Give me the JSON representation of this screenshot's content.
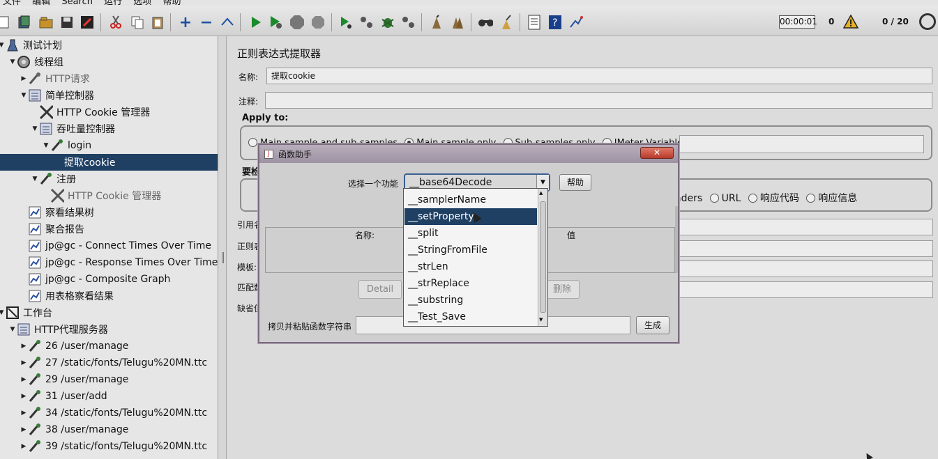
{
  "menubar": {
    "items": [
      "文件",
      "编辑",
      "Search",
      "运行",
      "选项",
      "帮助"
    ]
  },
  "toolbar": {
    "timer": "00:00:01",
    "error_count": "0",
    "thread_count": "0 / 20"
  },
  "tree": {
    "nodes": [
      "测试计划",
      "线程组",
      "HTTP请求",
      "简单控制器",
      "HTTP Cookie 管理器",
      "吞吐量控制器",
      "login",
      "提取cookie",
      "注册",
      "HTTP Cookie 管理器",
      "察看结果树",
      "聚合报告",
      "jp@gc - Connect Times Over Time",
      "jp@gc - Response Times Over Time",
      "jp@gc - Composite Graph",
      "用表格察看结果",
      "工作台",
      "HTTP代理服务器",
      "26 /user/manage",
      "27 /static/fonts/Telugu%20MN.ttc",
      "29 /user/manage",
      "31 /user/add",
      "34 /static/fonts/Telugu%20MN.ttc",
      "38 /user/manage",
      "39 /static/fonts/Telugu%20MN.ttc"
    ]
  },
  "panel": {
    "title": "正则表达式提取器",
    "name_label": "名称:",
    "name_value": "提取cookie",
    "comment_label": "注释:",
    "comment_value": "",
    "apply_to_title": "Apply to:",
    "apply_options": [
      "Main sample and sub-samples",
      "Main sample only",
      "Sub-samples only",
      "JMeter Variable"
    ],
    "field_to_check_title": "要检",
    "field_options": [
      "aders",
      "URL",
      "响应代码",
      "响应信息"
    ],
    "labels": [
      "引用名",
      "正则表",
      "模板:",
      "匹配数",
      "缺省值"
    ]
  },
  "dialog": {
    "title": "函数助手",
    "close": "✕",
    "choose_label": "选择一个功能",
    "selected_function": "__base64Decode",
    "help_button": "帮助",
    "col_name": "名称:",
    "col_value": "值",
    "detail_button": "Detail",
    "delete_button": "删除",
    "copy_label": "拷贝并粘贴函数字符串",
    "generate_button": "生成",
    "options": [
      "__samplerName",
      "__setProperty",
      "__split",
      "__StringFromFile",
      "__strLen",
      "__strReplace",
      "__substring",
      "__Test_Save"
    ],
    "highlighted_option": "__setProperty"
  }
}
